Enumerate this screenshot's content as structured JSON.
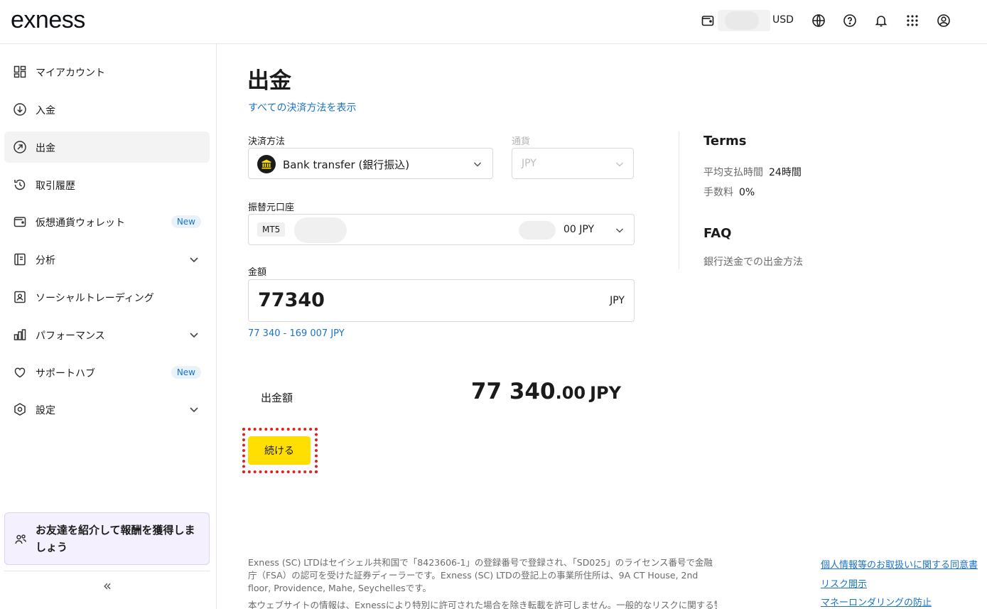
{
  "header": {
    "logo": "exness",
    "currency": "USD"
  },
  "sidebar": {
    "items": [
      {
        "label": "マイアカウント",
        "icon": "dashboard-icon"
      },
      {
        "label": "入金",
        "icon": "deposit-icon"
      },
      {
        "label": "出金",
        "icon": "withdraw-icon",
        "active": true
      },
      {
        "label": "取引履歴",
        "icon": "history-icon"
      },
      {
        "label": "仮想通貨ウォレット",
        "icon": "wallet-icon",
        "badge": "New"
      },
      {
        "label": "分析",
        "icon": "analytics-icon",
        "expandable": true
      },
      {
        "label": "ソーシャルトレーディング",
        "icon": "social-trading-icon"
      },
      {
        "label": "パフォーマンス",
        "icon": "performance-icon",
        "expandable": true
      },
      {
        "label": "サポートハブ",
        "icon": "heart-icon",
        "badge": "New"
      },
      {
        "label": "設定",
        "icon": "settings-icon",
        "expandable": true
      }
    ],
    "promo": "お友達を紹介して報酬を獲得しましょう",
    "collapse": "«"
  },
  "main": {
    "title": "出金",
    "all_methods_link": "すべての決済方法を表示",
    "method_label": "決済方法",
    "method_value": "Bank transfer (銀行振込)",
    "currency_label": "通貨",
    "currency_value": "JPY",
    "account_label": "振替元口座",
    "account_type": "MT5",
    "account_balance": "00 JPY",
    "amount_label": "金額",
    "amount_value": "77340",
    "amount_currency": "JPY",
    "amount_range": "77 340 - 169 007 JPY",
    "withdraw_label": "出金額",
    "withdraw_int": "77 340",
    "withdraw_dec": ".00",
    "withdraw_currency": "JPY",
    "continue_label": "続ける"
  },
  "terms": {
    "title": "Terms",
    "rows": [
      {
        "key": "平均支払時間",
        "value": "24時間"
      },
      {
        "key": "手数料",
        "value": "0%"
      }
    ],
    "faq_title": "FAQ",
    "faq_link": "銀行送金での出金方法"
  },
  "footer": {
    "text1": "Exness (SC) LTDはセイシェル共和国で「8423606-1」の登録番号で登録され、「SD025」のライセンス番号で金融庁（FSA）の認可を受けた証券ディーラーです。Exness (SC) LTDの登記上の事業所住所は、9A CT House, 2nd floor, Providence, Mahe, Seychellesです。",
    "text2": "本ウェブサイトの情報は、Exnessにより特別に許可された場合を除き転載を許可しません。一般的なリスクに関する警",
    "links": [
      "個人情報等のお取扱いに関する同意書",
      "リスク開示",
      "マネーロンダリングの防止"
    ]
  }
}
